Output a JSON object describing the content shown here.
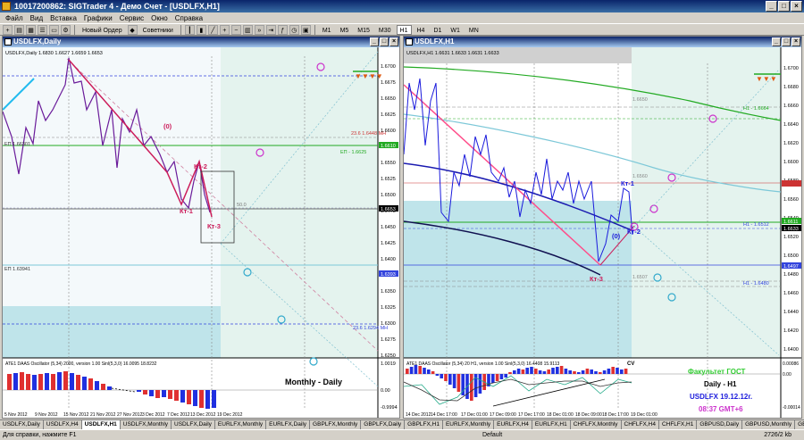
{
  "app": {
    "title": "10017200862: SIGTrader 4 - Демо Счет - [USDLFX,H1]"
  },
  "menu": [
    "Файл",
    "Вид",
    "Вставка",
    "Графики",
    "Сервис",
    "Окно",
    "Справка"
  ],
  "toolbar": {
    "new_order": "Новый Ордер",
    "advisors": "Советники",
    "timeframes": [
      "M1",
      "M5",
      "M15",
      "M30",
      "H1",
      "H4",
      "D1",
      "W1",
      "MN"
    ]
  },
  "left_chart": {
    "window_title": "USDLFX,Daily",
    "info": "USDLFX,Daily  1.6830 1.6627 1.6659 1.6653",
    "price_labels": [
      "1.6700",
      "1.6675",
      "1.6650",
      "1.6625",
      "1.6600",
      "1.6575",
      "1.6550",
      "1.6525",
      "1.6500",
      "1.6475",
      "1.6450",
      "1.6425",
      "1.6400",
      "1.6375",
      "1.6350",
      "1.6325",
      "1.6300",
      "1.6275",
      "1.6250"
    ],
    "marker_labels": [
      "(0)",
      "Кт-2",
      "Кт-1",
      "Кт-3"
    ],
    "level_labels": [
      "23.6  1.6448 МН",
      "ЕП - 1.6625",
      "ЕП  1.66301",
      "ЕП  1.63941",
      "23.6  1.6294 МН",
      "50.0"
    ],
    "highlight_price": "1.6653",
    "ep_price": "1.6610",
    "low_price": "1.6393",
    "osc_info": "АТЕ1 DAAS Oscillator (5,34) 2000, version 1.00  Sinl(5,3,0) 16.0095 18.8232",
    "osc_scale": [
      "1.0019",
      "0.00",
      "-0.9994"
    ],
    "dates": [
      "5 Nov 2012",
      "9 Nov 2012",
      "15 Nov 2012",
      "21 Nov 2012",
      "27 Nov 2012",
      "3 Dec 2012",
      "7 Dec 2012",
      "13 Dec 2012",
      "19 Dec 2012"
    ],
    "caption": "Monthly - Daily"
  },
  "right_chart": {
    "window_title": "USDLFX,H1",
    "info": "USDLFX,H1  1.6631 1.6633 1.6631 1.6633",
    "price_labels": [
      "1.6700",
      "1.6680",
      "1.6660",
      "1.6640",
      "1.6620",
      "1.6600",
      "1.6580",
      "1.6560",
      "1.6540",
      "1.6520",
      "1.6500",
      "1.6480",
      "1.6460",
      "1.6440",
      "1.6420",
      "1.6400"
    ],
    "marker_labels": [
      "Кт-1",
      "Кт-2",
      "(0)",
      "Кт-3"
    ],
    "level_labels": [
      "H1 - 1.6664",
      "H1 - 1.6512",
      "H1 - 1.6480",
      "1.6650",
      "1.6560",
      "1.6507"
    ],
    "highlight_price": "1.6633",
    "ep_price": "1.6611",
    "low_price": "1.6497",
    "osc_info": "АТЕ1 DAAS Oscillator (5,34) 20 H1, version 1.00  Sinl(5,3,0) 16.4408 15.9113",
    "osc_scale": [
      "0.00086",
      "0.00",
      "-0.00014"
    ],
    "dates": [
      "14 Dec 2012",
      "14 Dec 17:00",
      "17 Dec 01:00",
      "17 Dec 09:00",
      "17 Dec 17:00",
      "18 Dec 01:00",
      "18 Dec 09:00",
      "18 Dec 17:00",
      "19 Dec 01:00"
    ],
    "cv_label": "CV",
    "caption": [
      "Факультет ГОСТ",
      "Daily - H1",
      "USDLFX 19.12.12г.",
      "08:37  GMT+6"
    ]
  },
  "tabs": [
    "USDLFX,Daily",
    "USDLFX,H4",
    "USDLFX,H1",
    "USDLFX,Monthly",
    "USDLFX,Daily",
    "EURLFX,Monthly",
    "EURLFX,Daily",
    "GBPLFX,Monthly",
    "GBPLFX,Daily",
    "GBPLFX,H1",
    "EURLFX,Monthly",
    "EURLFX,H4",
    "EURLFX,H1",
    "CHFLFX,Monthly",
    "CHFLFX,H4",
    "CHFLFX,H1",
    "GBPUSD,Daily",
    "GBPUSD,Monthly",
    "GBPUSD,H1",
    "EURUSD,Daily",
    "EURUSD,H1",
    "USDCHF,Daily"
  ],
  "active_tab": 2,
  "status": {
    "help": "Для справки, нажмите F1",
    "profile": "Default",
    "traffic": "2726/2 kb"
  },
  "colors": {
    "chart_bg_left": "#f4f9fb",
    "zone_green": "#e4f3ee",
    "zone_teal": "#bfe4ea",
    "price_line": "#6a1b9a",
    "zigzag": "#cc1c5a",
    "caption_green": "#33cc33",
    "caption_blue": "#1a1adc",
    "caption_magenta": "#cc33cc"
  }
}
